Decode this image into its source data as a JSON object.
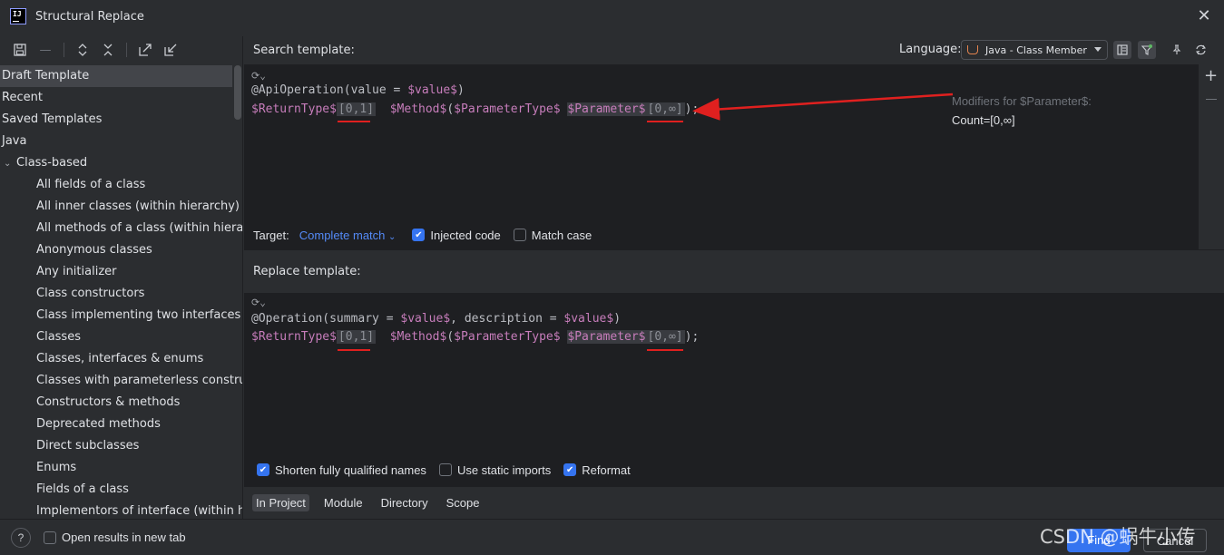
{
  "window": {
    "title": "Structural Replace"
  },
  "sidebar": {
    "items": [
      {
        "label": "Draft Template",
        "level": 0,
        "selected": true
      },
      {
        "label": "Recent",
        "level": 0
      },
      {
        "label": "Saved Templates",
        "level": 0
      },
      {
        "label": "Java",
        "level": 0
      },
      {
        "label": "Class-based",
        "level": "group"
      },
      {
        "label": "All fields of a class",
        "level": 1
      },
      {
        "label": "All inner classes (within hierarchy)",
        "level": 1
      },
      {
        "label": "All methods of a class (within hierarc",
        "level": 1
      },
      {
        "label": "Anonymous classes",
        "level": 1
      },
      {
        "label": "Any initializer",
        "level": 1
      },
      {
        "label": "Class constructors",
        "level": 1
      },
      {
        "label": "Class implementing two interfaces",
        "level": 1
      },
      {
        "label": "Classes",
        "level": 1
      },
      {
        "label": "Classes, interfaces & enums",
        "level": 1
      },
      {
        "label": "Classes with parameterless construc",
        "level": 1
      },
      {
        "label": "Constructors & methods",
        "level": 1
      },
      {
        "label": "Deprecated methods",
        "level": 1
      },
      {
        "label": "Direct subclasses",
        "level": 1
      },
      {
        "label": "Enums",
        "level": 1
      },
      {
        "label": "Fields of a class",
        "level": 1
      },
      {
        "label": "Implementors of interface (within hie",
        "level": 1
      }
    ]
  },
  "search": {
    "header": "Search template:",
    "language_label": "Language:",
    "language_value": "Java - Class Member",
    "line1": {
      "prefix": "@ApiOperation(value = ",
      "var": "$value$",
      "suffix": ")"
    },
    "line2": {
      "return_type": "$ReturnType$",
      "return_count": "[0,1]",
      "method": "$Method$",
      "open": "(",
      "param_type": "$ParameterType$",
      "param": "$Parameter$",
      "param_count": "[0,∞]",
      "close": ");"
    },
    "modifiers_label": "Modifiers for $Parameter$:",
    "count_label": "Count=[0,∞]",
    "target_label": "Target:",
    "target_value": "Complete match",
    "injected_code": "Injected code",
    "match_case": "Match case"
  },
  "replace": {
    "header": "Replace template:",
    "line1": {
      "prefix": "@Operation(summary = ",
      "var1": "$value$",
      "mid": ", description = ",
      "var2": "$value$",
      "suffix": ")"
    },
    "line2": {
      "return_type": "$ReturnType$",
      "return_count": "[0,1]",
      "method": "$Method$",
      "open": "(",
      "param_type": "$ParameterType$",
      "param": "$Parameter$",
      "param_count": "[0,∞]",
      "close": ");"
    },
    "shorten_names": "Shorten fully qualified names",
    "static_imports": "Use static imports",
    "reformat": "Reformat"
  },
  "scope": {
    "items": [
      "In Project",
      "Module",
      "Directory",
      "Scope"
    ]
  },
  "footer": {
    "open_new_tab": "Open results in new tab",
    "find": "Find",
    "cancel": "Cancel",
    "help": "?"
  },
  "watermark": "CSDN @蜗牛小传",
  "colors": {
    "accent": "#3574f0",
    "variable": "#c77dbb",
    "annotation_red": "#e0201f"
  }
}
